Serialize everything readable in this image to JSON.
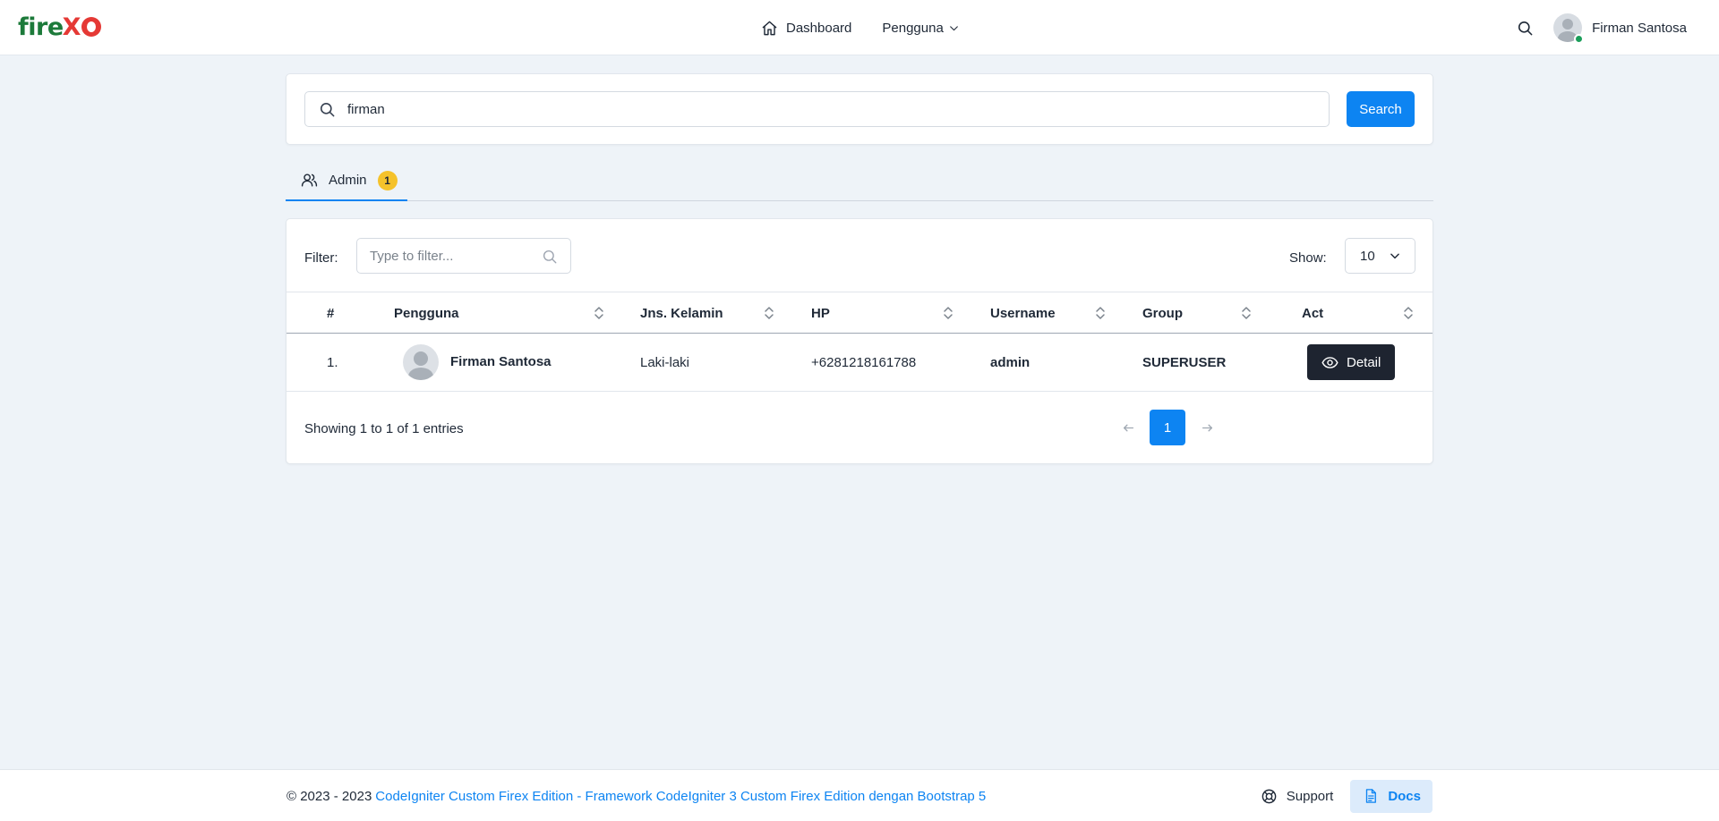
{
  "brand": {
    "logo_text": "fire",
    "logo_mark": "X",
    "logo_icon": "flame-icon",
    "accent": "#0d84f2",
    "brand_green": "#1c7a3a",
    "brand_red": "#e53935"
  },
  "nav": {
    "items": [
      {
        "label": "Dashboard",
        "icon": "home-icon"
      },
      {
        "label": "Pengguna",
        "icon": "chevron-down-icon"
      }
    ],
    "user_name": "Firman Santosa",
    "user_status_color": "#1b9e5a"
  },
  "search": {
    "value": "firman",
    "button_label": "Search"
  },
  "tabs": [
    {
      "label": "Admin",
      "count": "1",
      "icon": "users-icon"
    }
  ],
  "table": {
    "filter_label": "Filter:",
    "filter_placeholder": "Type to filter...",
    "show_label": "Show:",
    "show_value": "10",
    "columns": [
      "#",
      "Pengguna",
      "Jns. Kelamin",
      "HP",
      "Username",
      "Group",
      "Act"
    ],
    "rows": [
      {
        "no": "1.",
        "name": "Firman Santosa",
        "gender": "Laki-laki",
        "phone": "+6281218161788",
        "username": "admin",
        "group": "SUPERUSER",
        "action": "Detail"
      }
    ],
    "info": "Showing 1 to 1 of 1 entries",
    "pagination": {
      "current": "1"
    }
  },
  "footer": {
    "copyright": "© 2023 - 2023",
    "link_text": "CodeIgniter Custom Firex Edition - Framework CodeIgniter 3 Custom Firex Edition dengan Bootstrap 5",
    "support_label": "Support",
    "docs_label": "Docs"
  }
}
